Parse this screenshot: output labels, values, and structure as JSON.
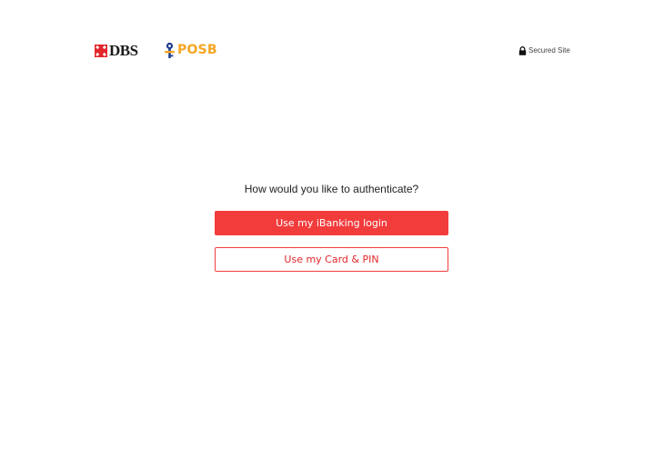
{
  "header": {
    "dbs_logo_text": "DBS",
    "posb_logo_text": "POSB",
    "secured_label": "Secured Site",
    "icons": {
      "dbs_mark": "dbs-star-icon",
      "posb_mark": "posb-key-icon",
      "lock": "lock-icon"
    }
  },
  "auth": {
    "question": "How would you like to authenticate?",
    "options": [
      {
        "label": "Use my iBanking login"
      },
      {
        "label": "Use my Card & PIN"
      }
    ]
  },
  "colors": {
    "brand_red": "#f23c3c",
    "posb_orange": "#f5a623",
    "posb_navy": "#1e3c8c"
  }
}
